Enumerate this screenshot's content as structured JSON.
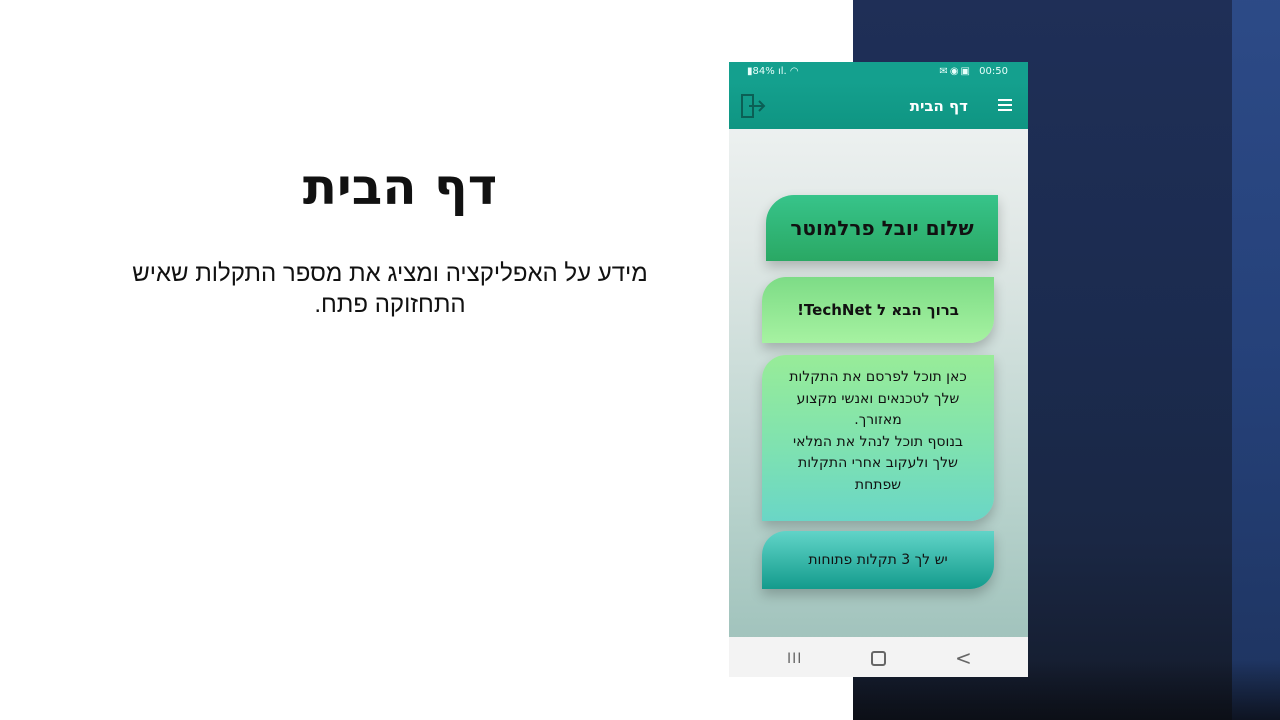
{
  "slide": {
    "title": "דף הבית",
    "body": "מידע על האפליקציה ומציג את מספר התקלות שאיש התחזוקה פתח."
  },
  "phone": {
    "status_bar": {
      "battery": "84%",
      "time": "00:50",
      "left_icons": "signal-icon wifi-icon",
      "right_icons": "mail-icon whatsapp-icon gallery-icon"
    },
    "app_bar": {
      "title": "דף הבית",
      "menu_icon": "hamburger-menu-icon",
      "exit_icon": "logout-icon"
    },
    "cards": {
      "greeting": "שלום יובל פרלמוטר",
      "welcome": "ברוך הבא ל TechNet!",
      "info_lines": [
        "כאן תוכל לפרסם את התקלות",
        "שלך לטכנאים ואנשי מקצוע",
        "מאזורך.",
        "בנוסף תוכל לנהל את המלאי",
        "שלך ולעקוב אחרי התקלות",
        "שפתחת"
      ],
      "open_issues": "יש לך 3 תקלות פתוחות"
    },
    "nav_bar": {
      "recent": "III",
      "back": "<"
    }
  },
  "colors": {
    "app_bar": "#14a08e",
    "greeting_card": "#2aa864",
    "welcome_card": "#a6f2a1",
    "open_issues_card": "#139b8c",
    "side_panel": "#1f2f57"
  }
}
